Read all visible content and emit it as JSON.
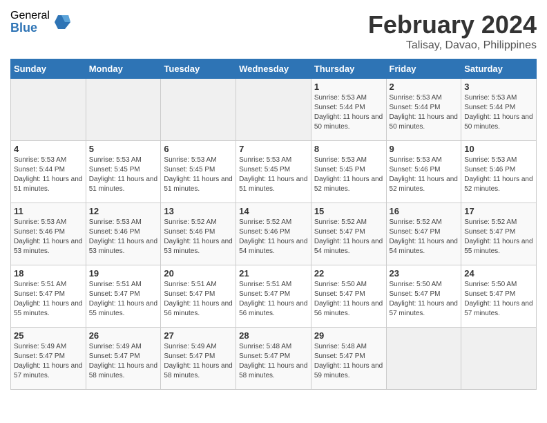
{
  "logo": {
    "general": "General",
    "blue": "Blue"
  },
  "title": "February 2024",
  "location": "Talisay, Davao, Philippines",
  "days_of_week": [
    "Sunday",
    "Monday",
    "Tuesday",
    "Wednesday",
    "Thursday",
    "Friday",
    "Saturday"
  ],
  "weeks": [
    [
      {
        "day": "",
        "sunrise": "",
        "sunset": "",
        "daylight": "",
        "empty": true
      },
      {
        "day": "",
        "sunrise": "",
        "sunset": "",
        "daylight": "",
        "empty": true
      },
      {
        "day": "",
        "sunrise": "",
        "sunset": "",
        "daylight": "",
        "empty": true
      },
      {
        "day": "",
        "sunrise": "",
        "sunset": "",
        "daylight": "",
        "empty": true
      },
      {
        "day": "1",
        "sunrise": "Sunrise: 5:53 AM",
        "sunset": "Sunset: 5:44 PM",
        "daylight": "Daylight: 11 hours and 50 minutes.",
        "empty": false
      },
      {
        "day": "2",
        "sunrise": "Sunrise: 5:53 AM",
        "sunset": "Sunset: 5:44 PM",
        "daylight": "Daylight: 11 hours and 50 minutes.",
        "empty": false
      },
      {
        "day": "3",
        "sunrise": "Sunrise: 5:53 AM",
        "sunset": "Sunset: 5:44 PM",
        "daylight": "Daylight: 11 hours and 50 minutes.",
        "empty": false
      }
    ],
    [
      {
        "day": "4",
        "sunrise": "Sunrise: 5:53 AM",
        "sunset": "Sunset: 5:44 PM",
        "daylight": "Daylight: 11 hours and 51 minutes.",
        "empty": false
      },
      {
        "day": "5",
        "sunrise": "Sunrise: 5:53 AM",
        "sunset": "Sunset: 5:45 PM",
        "daylight": "Daylight: 11 hours and 51 minutes.",
        "empty": false
      },
      {
        "day": "6",
        "sunrise": "Sunrise: 5:53 AM",
        "sunset": "Sunset: 5:45 PM",
        "daylight": "Daylight: 11 hours and 51 minutes.",
        "empty": false
      },
      {
        "day": "7",
        "sunrise": "Sunrise: 5:53 AM",
        "sunset": "Sunset: 5:45 PM",
        "daylight": "Daylight: 11 hours and 51 minutes.",
        "empty": false
      },
      {
        "day": "8",
        "sunrise": "Sunrise: 5:53 AM",
        "sunset": "Sunset: 5:45 PM",
        "daylight": "Daylight: 11 hours and 52 minutes.",
        "empty": false
      },
      {
        "day": "9",
        "sunrise": "Sunrise: 5:53 AM",
        "sunset": "Sunset: 5:46 PM",
        "daylight": "Daylight: 11 hours and 52 minutes.",
        "empty": false
      },
      {
        "day": "10",
        "sunrise": "Sunrise: 5:53 AM",
        "sunset": "Sunset: 5:46 PM",
        "daylight": "Daylight: 11 hours and 52 minutes.",
        "empty": false
      }
    ],
    [
      {
        "day": "11",
        "sunrise": "Sunrise: 5:53 AM",
        "sunset": "Sunset: 5:46 PM",
        "daylight": "Daylight: 11 hours and 53 minutes.",
        "empty": false
      },
      {
        "day": "12",
        "sunrise": "Sunrise: 5:53 AM",
        "sunset": "Sunset: 5:46 PM",
        "daylight": "Daylight: 11 hours and 53 minutes.",
        "empty": false
      },
      {
        "day": "13",
        "sunrise": "Sunrise: 5:52 AM",
        "sunset": "Sunset: 5:46 PM",
        "daylight": "Daylight: 11 hours and 53 minutes.",
        "empty": false
      },
      {
        "day": "14",
        "sunrise": "Sunrise: 5:52 AM",
        "sunset": "Sunset: 5:46 PM",
        "daylight": "Daylight: 11 hours and 54 minutes.",
        "empty": false
      },
      {
        "day": "15",
        "sunrise": "Sunrise: 5:52 AM",
        "sunset": "Sunset: 5:47 PM",
        "daylight": "Daylight: 11 hours and 54 minutes.",
        "empty": false
      },
      {
        "day": "16",
        "sunrise": "Sunrise: 5:52 AM",
        "sunset": "Sunset: 5:47 PM",
        "daylight": "Daylight: 11 hours and 54 minutes.",
        "empty": false
      },
      {
        "day": "17",
        "sunrise": "Sunrise: 5:52 AM",
        "sunset": "Sunset: 5:47 PM",
        "daylight": "Daylight: 11 hours and 55 minutes.",
        "empty": false
      }
    ],
    [
      {
        "day": "18",
        "sunrise": "Sunrise: 5:51 AM",
        "sunset": "Sunset: 5:47 PM",
        "daylight": "Daylight: 11 hours and 55 minutes.",
        "empty": false
      },
      {
        "day": "19",
        "sunrise": "Sunrise: 5:51 AM",
        "sunset": "Sunset: 5:47 PM",
        "daylight": "Daylight: 11 hours and 55 minutes.",
        "empty": false
      },
      {
        "day": "20",
        "sunrise": "Sunrise: 5:51 AM",
        "sunset": "Sunset: 5:47 PM",
        "daylight": "Daylight: 11 hours and 56 minutes.",
        "empty": false
      },
      {
        "day": "21",
        "sunrise": "Sunrise: 5:51 AM",
        "sunset": "Sunset: 5:47 PM",
        "daylight": "Daylight: 11 hours and 56 minutes.",
        "empty": false
      },
      {
        "day": "22",
        "sunrise": "Sunrise: 5:50 AM",
        "sunset": "Sunset: 5:47 PM",
        "daylight": "Daylight: 11 hours and 56 minutes.",
        "empty": false
      },
      {
        "day": "23",
        "sunrise": "Sunrise: 5:50 AM",
        "sunset": "Sunset: 5:47 PM",
        "daylight": "Daylight: 11 hours and 57 minutes.",
        "empty": false
      },
      {
        "day": "24",
        "sunrise": "Sunrise: 5:50 AM",
        "sunset": "Sunset: 5:47 PM",
        "daylight": "Daylight: 11 hours and 57 minutes.",
        "empty": false
      }
    ],
    [
      {
        "day": "25",
        "sunrise": "Sunrise: 5:49 AM",
        "sunset": "Sunset: 5:47 PM",
        "daylight": "Daylight: 11 hours and 57 minutes.",
        "empty": false
      },
      {
        "day": "26",
        "sunrise": "Sunrise: 5:49 AM",
        "sunset": "Sunset: 5:47 PM",
        "daylight": "Daylight: 11 hours and 58 minutes.",
        "empty": false
      },
      {
        "day": "27",
        "sunrise": "Sunrise: 5:49 AM",
        "sunset": "Sunset: 5:47 PM",
        "daylight": "Daylight: 11 hours and 58 minutes.",
        "empty": false
      },
      {
        "day": "28",
        "sunrise": "Sunrise: 5:48 AM",
        "sunset": "Sunset: 5:47 PM",
        "daylight": "Daylight: 11 hours and 58 minutes.",
        "empty": false
      },
      {
        "day": "29",
        "sunrise": "Sunrise: 5:48 AM",
        "sunset": "Sunset: 5:47 PM",
        "daylight": "Daylight: 11 hours and 59 minutes.",
        "empty": false
      },
      {
        "day": "",
        "sunrise": "",
        "sunset": "",
        "daylight": "",
        "empty": true
      },
      {
        "day": "",
        "sunrise": "",
        "sunset": "",
        "daylight": "",
        "empty": true
      }
    ]
  ]
}
